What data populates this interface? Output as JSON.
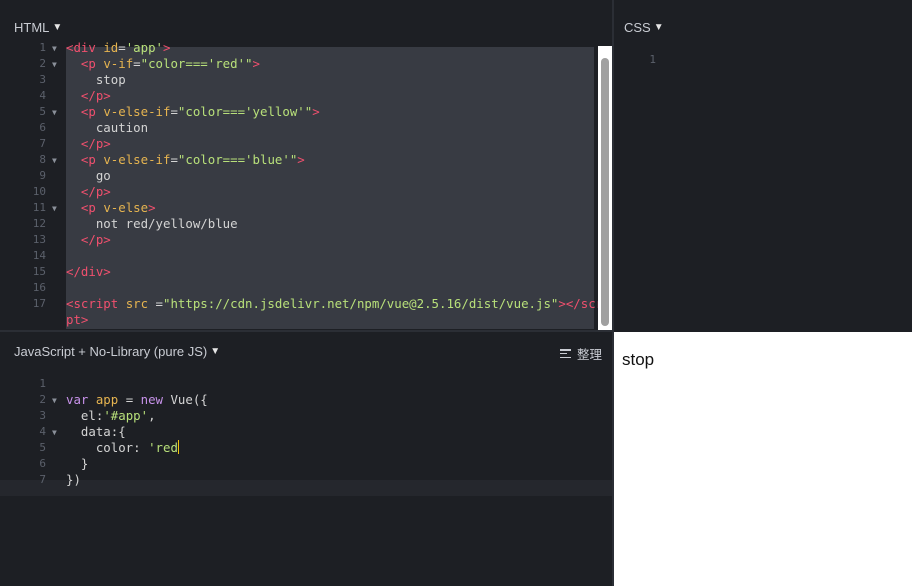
{
  "html_panel": {
    "title": "HTML",
    "lines": [
      {
        "n": "1",
        "fold": true,
        "segs": [
          [
            "tag",
            "<div "
          ],
          [
            "attr",
            "id"
          ],
          [
            "pl",
            "="
          ],
          [
            "str",
            "'app'"
          ],
          [
            "tag",
            ">"
          ]
        ]
      },
      {
        "n": "2",
        "fold": true,
        "segs": [
          [
            "pl",
            "  "
          ],
          [
            "tag",
            "<p "
          ],
          [
            "attr",
            "v-if"
          ],
          [
            "pl",
            "="
          ],
          [
            "str",
            "\"color==='red'\""
          ],
          [
            "tag",
            ">"
          ]
        ]
      },
      {
        "n": "3",
        "fold": false,
        "segs": [
          [
            "pl",
            "    stop"
          ]
        ]
      },
      {
        "n": "4",
        "fold": false,
        "segs": [
          [
            "pl",
            "  "
          ],
          [
            "tag",
            "</p>"
          ]
        ]
      },
      {
        "n": "5",
        "fold": true,
        "segs": [
          [
            "pl",
            "  "
          ],
          [
            "tag",
            "<p "
          ],
          [
            "attr",
            "v-else-if"
          ],
          [
            "pl",
            "="
          ],
          [
            "str",
            "\"color==='yellow'\""
          ],
          [
            "tag",
            ">"
          ]
        ]
      },
      {
        "n": "6",
        "fold": false,
        "segs": [
          [
            "pl",
            "    caution"
          ]
        ]
      },
      {
        "n": "7",
        "fold": false,
        "segs": [
          [
            "pl",
            "  "
          ],
          [
            "tag",
            "</p>"
          ]
        ]
      },
      {
        "n": "8",
        "fold": true,
        "segs": [
          [
            "pl",
            "  "
          ],
          [
            "tag",
            "<p "
          ],
          [
            "attr",
            "v-else-if"
          ],
          [
            "pl",
            "="
          ],
          [
            "str",
            "\"color==='blue'\""
          ],
          [
            "tag",
            ">"
          ]
        ]
      },
      {
        "n": "9",
        "fold": false,
        "segs": [
          [
            "pl",
            "    go"
          ]
        ]
      },
      {
        "n": "10",
        "fold": false,
        "segs": [
          [
            "pl",
            "  "
          ],
          [
            "tag",
            "</p>"
          ]
        ]
      },
      {
        "n": "11",
        "fold": true,
        "segs": [
          [
            "pl",
            "  "
          ],
          [
            "tag",
            "<p "
          ],
          [
            "attr",
            "v-else"
          ],
          [
            "tag",
            ">"
          ]
        ]
      },
      {
        "n": "12",
        "fold": false,
        "segs": [
          [
            "pl",
            "    not red/yellow/blue"
          ]
        ]
      },
      {
        "n": "13",
        "fold": false,
        "segs": [
          [
            "pl",
            "  "
          ],
          [
            "tag",
            "</p>"
          ]
        ]
      },
      {
        "n": "14",
        "fold": false,
        "segs": []
      },
      {
        "n": "15",
        "fold": false,
        "segs": [
          [
            "tag",
            "</div>"
          ]
        ]
      },
      {
        "n": "16",
        "fold": false,
        "segs": []
      },
      {
        "n": "17",
        "fold": false,
        "segs": [
          [
            "tag",
            "<script "
          ],
          [
            "attr",
            "src"
          ],
          [
            "pl",
            " ="
          ],
          [
            "str",
            "\"https://cdn.jsdelivr.net/npm/vue@2.5.16/dist/vue.js\""
          ],
          [
            "tag",
            "></scri"
          ]
        ]
      },
      {
        "n": "",
        "fold": false,
        "segs": [
          [
            "tag",
            "pt>"
          ]
        ]
      }
    ]
  },
  "css_panel": {
    "title": "CSS",
    "lines": [
      {
        "n": "1",
        "fold": false,
        "segs": []
      }
    ]
  },
  "js_panel": {
    "title": "JavaScript + No-Library (pure JS)",
    "tidy_label": "整理",
    "lines": [
      {
        "n": "1",
        "fold": false,
        "segs": []
      },
      {
        "n": "2",
        "fold": true,
        "segs": [
          [
            "kw",
            "var "
          ],
          [
            "attr",
            "app"
          ],
          [
            "pl",
            " = "
          ],
          [
            "kw",
            "new "
          ],
          [
            "pl",
            "Vue({"
          ]
        ]
      },
      {
        "n": "3",
        "fold": false,
        "segs": [
          [
            "pl",
            "  el:"
          ],
          [
            "str",
            "'#app'"
          ],
          [
            "pl",
            ","
          ]
        ]
      },
      {
        "n": "4",
        "fold": true,
        "segs": [
          [
            "pl",
            "  data:{"
          ]
        ]
      },
      {
        "n": "5",
        "fold": false,
        "segs": [
          [
            "pl",
            "    color: "
          ],
          [
            "str",
            "'red"
          ],
          [
            "cursor",
            ""
          ]
        ]
      },
      {
        "n": "6",
        "fold": false,
        "segs": [
          [
            "pl",
            "  }"
          ]
        ]
      },
      {
        "n": "7",
        "fold": false,
        "segs": [
          [
            "pl",
            "})"
          ]
        ]
      }
    ]
  },
  "result_panel": {
    "text": "stop"
  },
  "icons": {
    "caret": "caret-down-icon",
    "fold": "fold-triangle-icon",
    "tidy": "tidy-lines-icon"
  }
}
